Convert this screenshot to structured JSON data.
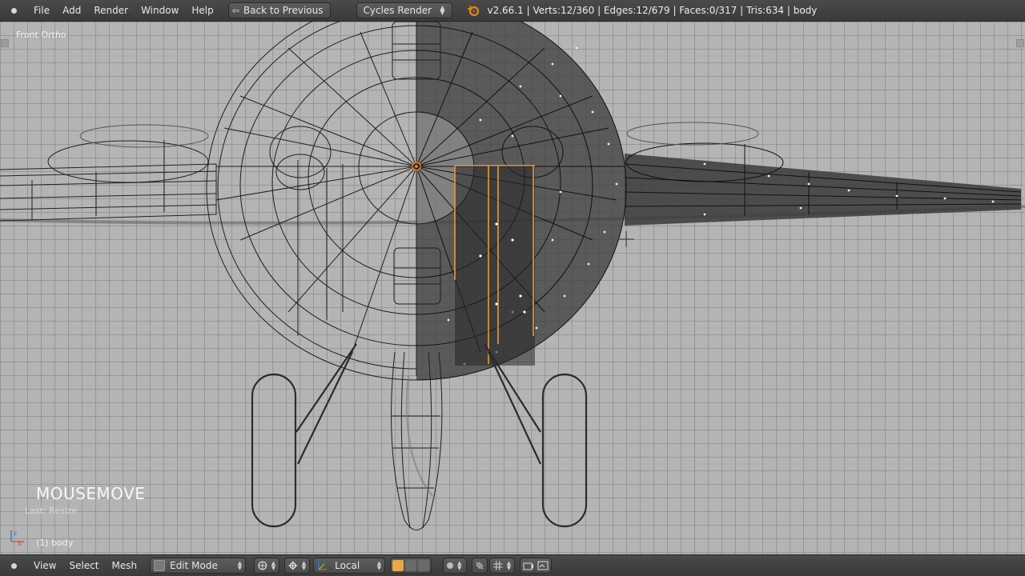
{
  "top_header": {
    "menus": [
      "File",
      "Add",
      "Render",
      "Window",
      "Help"
    ],
    "back_button": "Back to Previous",
    "render_engine": "Cycles Render",
    "stats": "v2.66.1 | Verts:12/360 | Edges:12/679 | Faces:0/317 | Tris:634 | body"
  },
  "viewport": {
    "view_label": "Front Ortho",
    "operator_name": "MOUSEMOVE",
    "last_operator": "Last: Resize",
    "active_object": "(1) body"
  },
  "bottom_header": {
    "menus": [
      "View",
      "Select",
      "Mesh"
    ],
    "mode": "Edit Mode",
    "transform_orientation": "Local"
  },
  "colors": {
    "header_bg": "#424242",
    "viewport_bg": "#b3b5b3",
    "selection_orange": "#e89a3c",
    "wire": "#1e1e1e"
  }
}
